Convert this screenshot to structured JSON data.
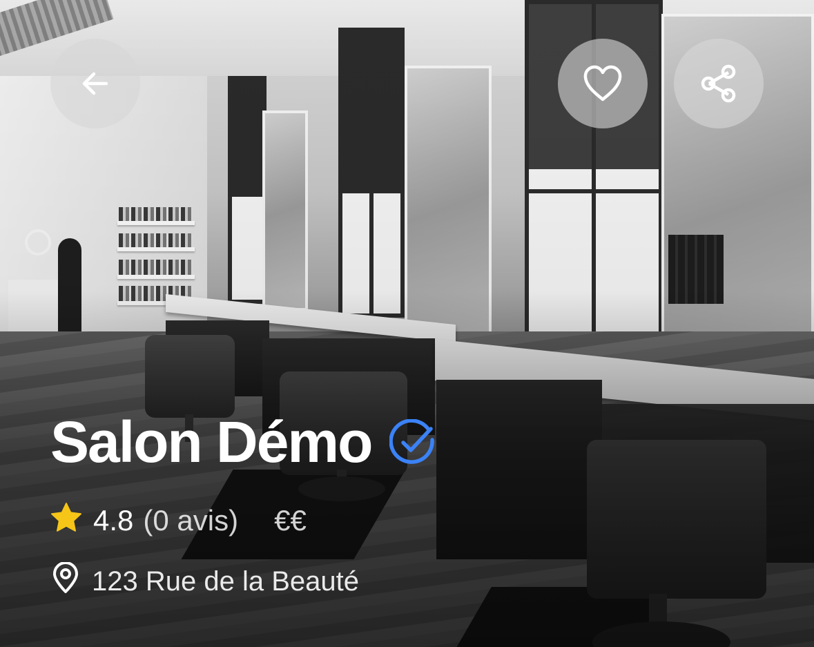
{
  "header": {
    "back_icon": "arrow-left-icon",
    "favorite_icon": "heart-outline-icon",
    "share_icon": "share-icon"
  },
  "salon": {
    "name": "Salon Démo",
    "verified_icon": "verified-check-badge-icon",
    "verified_color": "#3B82F6",
    "rating": "4.8",
    "reviews": "(0 avis)",
    "price_level": "€€",
    "star_icon": "star-icon",
    "star_color": "#F5C518",
    "address": "123 Rue de la Beauté",
    "address_icon": "location-pin-icon"
  },
  "hero_image": {
    "description_icon": "salon-photo",
    "style": "black-and-white"
  }
}
